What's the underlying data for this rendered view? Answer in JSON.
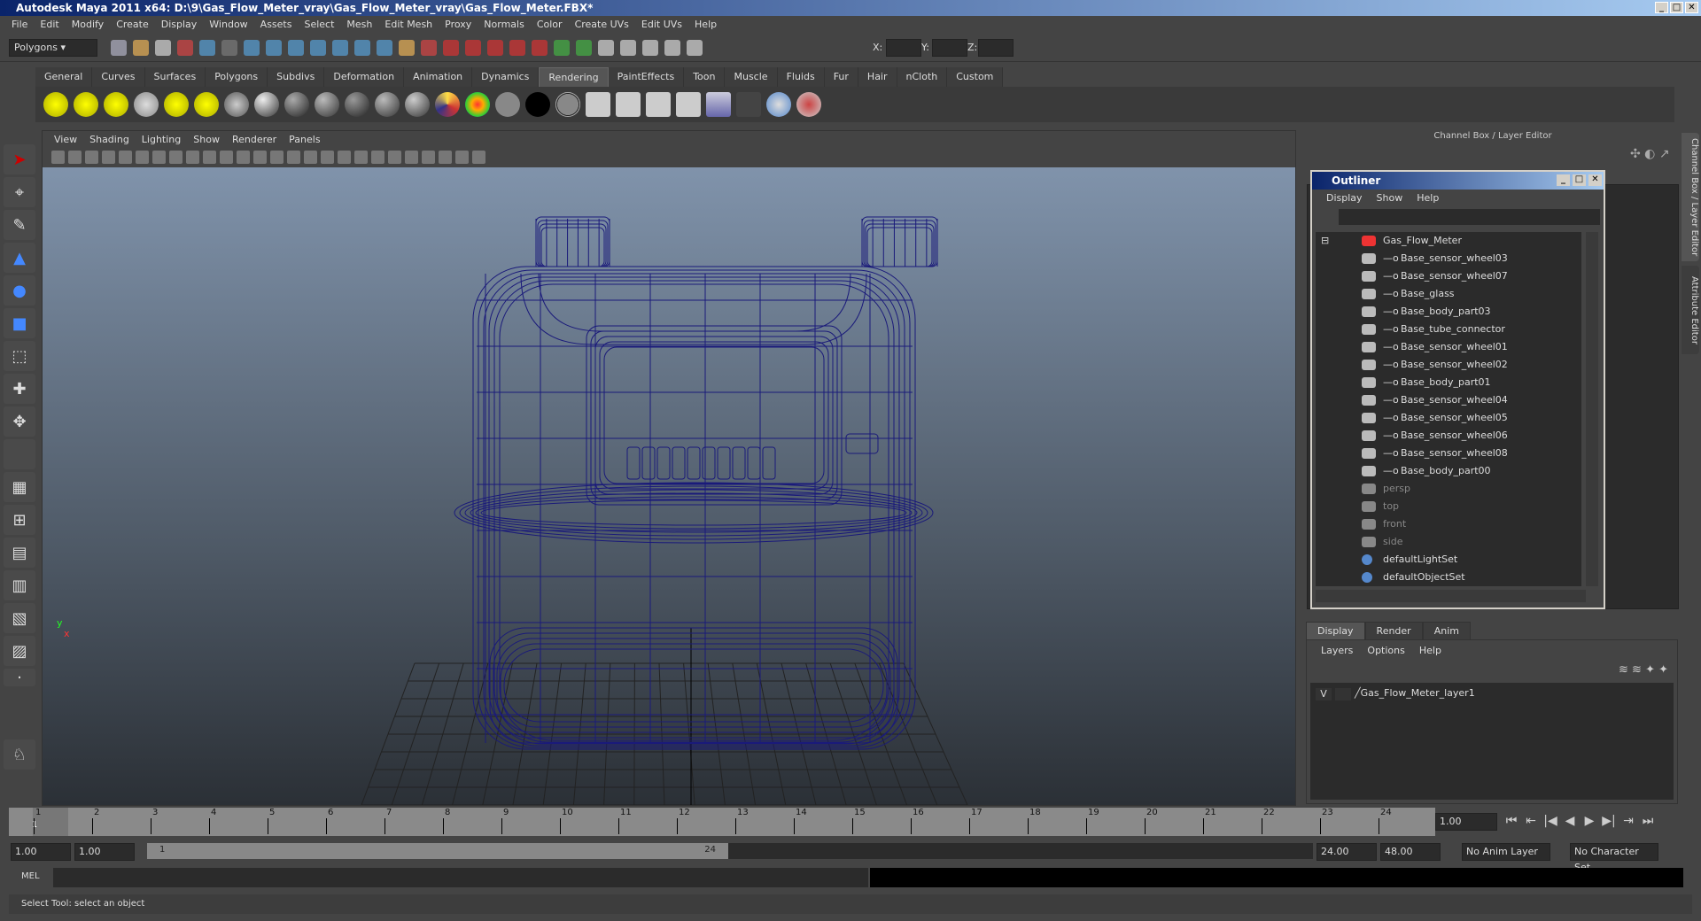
{
  "window": {
    "title": "Autodesk Maya 2011 x64: D:\\9\\Gas_Flow_Meter_vray\\Gas_Flow_Meter_vray\\Gas_Flow_Meter.FBX*",
    "min": "_",
    "max": "□",
    "close": "✕"
  },
  "menu": [
    "File",
    "Edit",
    "Modify",
    "Create",
    "Display",
    "Window",
    "Assets",
    "Select",
    "Mesh",
    "Edit Mesh",
    "Proxy",
    "Normals",
    "Color",
    "Create UVs",
    "Edit UVs",
    "Help"
  ],
  "statusline": {
    "mode": "Polygons",
    "x_label": "X:",
    "y_label": "Y:",
    "z_label": "Z:"
  },
  "shelf": {
    "tabs": [
      "General",
      "Curves",
      "Surfaces",
      "Polygons",
      "Subdivs",
      "Deformation",
      "Animation",
      "Dynamics",
      "Rendering",
      "PaintEffects",
      "Toon",
      "Muscle",
      "Fluids",
      "Fur",
      "Hair",
      "nCloth",
      "Custom"
    ],
    "active": "Rendering"
  },
  "viewport": {
    "menu": [
      "View",
      "Shading",
      "Lighting",
      "Show",
      "Renderer",
      "Panels"
    ],
    "wire_color": "#1a1a7a",
    "axis_x": "x",
    "axis_y": "y"
  },
  "channelbox": {
    "title": "Channel Box / Layer Editor",
    "vtab1": "Channel Box / Layer Editor",
    "vtab2": "Attribute Editor"
  },
  "outliner": {
    "title": "Outliner",
    "menu": [
      "Display",
      "Show",
      "Help"
    ],
    "items": [
      {
        "label": "Gas_Flow_Meter",
        "type": "root"
      },
      {
        "label": "Base_sensor_wheel03",
        "type": "mesh"
      },
      {
        "label": "Base_sensor_wheel07",
        "type": "mesh"
      },
      {
        "label": "Base_glass",
        "type": "mesh"
      },
      {
        "label": "Base_body_part03",
        "type": "mesh"
      },
      {
        "label": "Base_tube_connector",
        "type": "mesh"
      },
      {
        "label": "Base_sensor_wheel01",
        "type": "mesh"
      },
      {
        "label": "Base_sensor_wheel02",
        "type": "mesh"
      },
      {
        "label": "Base_body_part01",
        "type": "mesh"
      },
      {
        "label": "Base_sensor_wheel04",
        "type": "mesh"
      },
      {
        "label": "Base_sensor_wheel05",
        "type": "mesh"
      },
      {
        "label": "Base_sensor_wheel06",
        "type": "mesh"
      },
      {
        "label": "Base_sensor_wheel08",
        "type": "mesh"
      },
      {
        "label": "Base_body_part00",
        "type": "mesh"
      },
      {
        "label": "persp",
        "type": "camera"
      },
      {
        "label": "top",
        "type": "camera"
      },
      {
        "label": "front",
        "type": "camera"
      },
      {
        "label": "side",
        "type": "camera"
      },
      {
        "label": "defaultLightSet",
        "type": "set"
      },
      {
        "label": "defaultObjectSet",
        "type": "set"
      }
    ]
  },
  "layers": {
    "tabs": [
      "Display",
      "Render",
      "Anim"
    ],
    "active": "Display",
    "menu": [
      "Layers",
      "Options",
      "Help"
    ],
    "visible_flag": "V",
    "layer_name": "Gas_Flow_Meter_layer1"
  },
  "timeline": {
    "frames": [
      "1",
      "2",
      "3",
      "4",
      "5",
      "6",
      "7",
      "8",
      "9",
      "10",
      "11",
      "12",
      "13",
      "14",
      "15",
      "16",
      "17",
      "18",
      "19",
      "20",
      "21",
      "22",
      "23",
      "24"
    ],
    "current": "1",
    "current_field": "1.00"
  },
  "range": {
    "start": "1.00",
    "start2": "1.00",
    "slider_start": "1",
    "slider_end": "24",
    "end": "24.00",
    "end2": "48.00",
    "anim_layer": "No Anim Layer",
    "char_set": "No Character Set"
  },
  "mel": {
    "label": "MEL"
  },
  "help": {
    "text": "Select Tool: select an object"
  }
}
